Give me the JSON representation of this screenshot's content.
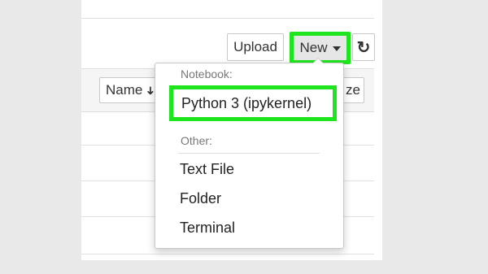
{
  "toolbar": {
    "upload_label": "Upload",
    "new_label": "New",
    "refresh_icon": "↻"
  },
  "list_header": {
    "name_label": "Name",
    "sort_arrow": "➜",
    "size_label": "ze"
  },
  "new_menu": {
    "notebook_header": "Notebook:",
    "python_kernel_label": "Python 3 (ipykernel)",
    "other_header": "Other:",
    "items": [
      "Text File",
      "Folder",
      "Terminal"
    ]
  },
  "colors": {
    "highlight": "#1fe51f",
    "background": "#e9e9e9"
  }
}
